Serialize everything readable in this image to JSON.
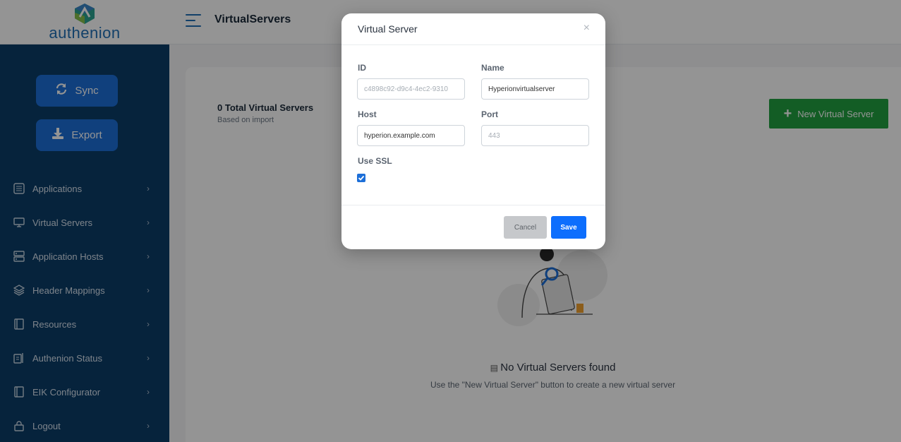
{
  "brand": {
    "name": "authenion",
    "color": "#1f6fb5"
  },
  "header": {
    "title": "VirtualServers"
  },
  "sidebar": {
    "sync_label": "Sync",
    "export_label": "Export",
    "items": [
      {
        "label": "Applications",
        "icon": "list-icon"
      },
      {
        "label": "Virtual Servers",
        "icon": "monitor-icon"
      },
      {
        "label": "Application Hosts",
        "icon": "server-icon"
      },
      {
        "label": "Header Mappings",
        "icon": "layers-icon"
      },
      {
        "label": "Resources",
        "icon": "book-icon"
      },
      {
        "label": "Authenion Status",
        "icon": "status-icon"
      },
      {
        "label": "EIK Configurator",
        "icon": "book-icon"
      },
      {
        "label": "Logout",
        "icon": "lock-icon"
      }
    ]
  },
  "main": {
    "total_title": "0 Total Virtual Servers",
    "total_sub": "Based on import",
    "new_button_label": "New Virtual Server",
    "empty_title": "No Virtual Servers found",
    "empty_sub": "Use the \"New Virtual Server\" button to create a new virtual server"
  },
  "modal": {
    "title": "Virtual Server",
    "fields": {
      "id_label": "ID",
      "id_placeholder": "c4898c92-d9c4-4ec2-9310",
      "name_label": "Name",
      "name_value": "Hyperionvirtualserver",
      "host_label": "Host",
      "host_value": "hyperion.example.com",
      "port_label": "Port",
      "port_placeholder": "443",
      "ssl_label": "Use SSL",
      "ssl_checked": true
    },
    "cancel_label": "Cancel",
    "save_label": "Save"
  },
  "colors": {
    "sidebar_bg": "#0b3d68",
    "primary": "#1d6fd8",
    "success": "#22a041",
    "save": "#0d6efd"
  }
}
